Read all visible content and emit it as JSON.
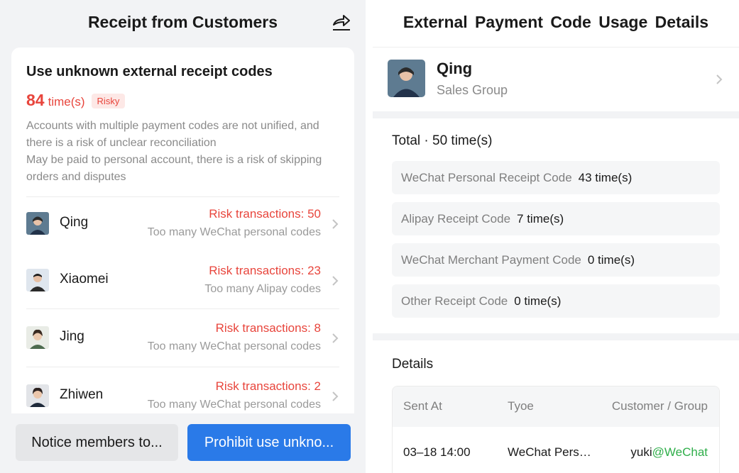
{
  "left": {
    "title": "Receipt from Customers",
    "card": {
      "title": "Use unknown external receipt codes",
      "count": "84",
      "count_unit": "time(s)",
      "badge": "Risky",
      "desc1": "Accounts with multiple payment codes are not unified, and there is a risk of unclear reconciliation",
      "desc2": "May be paid to personal account, there is a risk of skipping orders and disputes"
    },
    "members": [
      {
        "name": "Qing",
        "risk": "Risk transactions: 50",
        "reason": "Too many WeChat personal codes"
      },
      {
        "name": "Xiaomei",
        "risk": "Risk transactions: 23",
        "reason": "Too many Alipay codes"
      },
      {
        "name": "Jing",
        "risk": "Risk transactions: 8",
        "reason": "Too many WeChat personal codes"
      },
      {
        "name": "Zhiwen",
        "risk": "Risk transactions: 2",
        "reason": "Too many WeChat personal codes"
      }
    ],
    "buttons": {
      "notice": "Notice members to...",
      "prohibit": "Prohibit use unkno..."
    }
  },
  "right": {
    "title": "External Payment Code  Usage Details",
    "profile": {
      "name": "Qing",
      "group": "Sales Group"
    },
    "total": "Total · 50 time(s)",
    "codes": [
      {
        "label": "WeChat Personal Receipt Code",
        "count": "43 time(s)"
      },
      {
        "label": "Alipay Receipt Code",
        "count": "7 time(s)"
      },
      {
        "label": "WeChat Merchant Payment Code",
        "count": "0 time(s)"
      },
      {
        "label": "Other Receipt Code",
        "count": "0 time(s)"
      }
    ],
    "details_title": "Details",
    "table": {
      "headers": [
        "Sent At",
        "Tyoe",
        "Customer / Group"
      ],
      "rows": [
        {
          "sent_at": "03–18 14:00",
          "type": "WeChat Pers…",
          "customer": "yuki",
          "customer_suffix": "@WeChat"
        }
      ]
    }
  },
  "colors": {
    "risk_red": "#e8453c",
    "primary_blue": "#2a7ae8",
    "wechat_green": "#2fae4a"
  },
  "icons": [
    "share-icon",
    "chevron-right-icon",
    "avatar"
  ]
}
